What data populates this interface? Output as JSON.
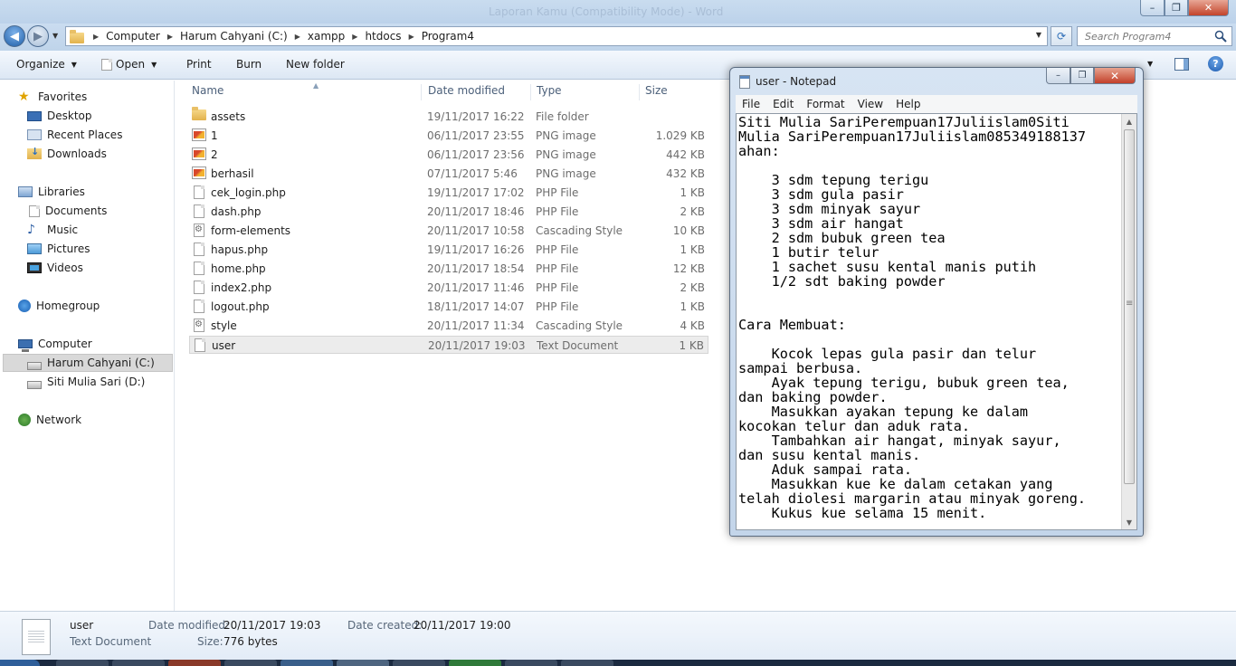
{
  "titlebar": {
    "faint_title": "Laporan Kamu (Compatibility Mode) - Word"
  },
  "window_controls": {
    "minimize": "–",
    "maximize": "❐",
    "close": "✕"
  },
  "nav": {
    "back": "◀",
    "forward": "▶",
    "breadcrumbs": [
      "Computer",
      "Harum Cahyani (C:)",
      "xampp",
      "htdocs",
      "Program4"
    ],
    "search_placeholder": "Search Program4"
  },
  "toolbar": {
    "organize": "Organize",
    "open": "Open",
    "print": "Print",
    "burn": "Burn",
    "new_folder": "New folder"
  },
  "sidebar": {
    "favorites": "Favorites",
    "desktop": "Desktop",
    "recent_places": "Recent Places",
    "downloads": "Downloads",
    "libraries": "Libraries",
    "documents": "Documents",
    "music": "Music",
    "pictures": "Pictures",
    "videos": "Videos",
    "homegroup": "Homegroup",
    "computer": "Computer",
    "drive_c": "Harum Cahyani (C:)",
    "drive_d": "Siti Mulia Sari (D:)",
    "network": "Network"
  },
  "filelist": {
    "columns": {
      "name": "Name",
      "date": "Date modified",
      "type": "Type",
      "size": "Size"
    },
    "files": [
      {
        "name": "assets",
        "date": "19/11/2017 16:22",
        "type": "File folder",
        "size": "",
        "icon": "folder-icon"
      },
      {
        "name": "1",
        "date": "06/11/2017 23:55",
        "type": "PNG image",
        "size": "1.029 KB",
        "icon": "png-image-icon"
      },
      {
        "name": "2",
        "date": "06/11/2017 23:56",
        "type": "PNG image",
        "size": "442 KB",
        "icon": "png-image-icon"
      },
      {
        "name": "berhasil",
        "date": "07/11/2017 5:46",
        "type": "PNG image",
        "size": "432 KB",
        "icon": "png-image-icon"
      },
      {
        "name": "cek_login.php",
        "date": "19/11/2017 17:02",
        "type": "PHP File",
        "size": "1 KB",
        "icon": "php-file-icon"
      },
      {
        "name": "dash.php",
        "date": "20/11/2017 18:46",
        "type": "PHP File",
        "size": "2 KB",
        "icon": "php-file-icon"
      },
      {
        "name": "form-elements",
        "date": "20/11/2017 10:58",
        "type": "Cascading Style S...",
        "size": "10 KB",
        "icon": "css-file-icon"
      },
      {
        "name": "hapus.php",
        "date": "19/11/2017 16:26",
        "type": "PHP File",
        "size": "1 KB",
        "icon": "php-file-icon"
      },
      {
        "name": "home.php",
        "date": "20/11/2017 18:54",
        "type": "PHP File",
        "size": "12 KB",
        "icon": "php-file-icon"
      },
      {
        "name": "index2.php",
        "date": "20/11/2017 11:46",
        "type": "PHP File",
        "size": "2 KB",
        "icon": "php-file-icon"
      },
      {
        "name": "logout.php",
        "date": "18/11/2017 14:07",
        "type": "PHP File",
        "size": "1 KB",
        "icon": "php-file-icon"
      },
      {
        "name": "style",
        "date": "20/11/2017 11:34",
        "type": "Cascading Style S...",
        "size": "4 KB",
        "icon": "css-file-icon"
      },
      {
        "name": "user",
        "date": "20/11/2017 19:03",
        "type": "Text Document",
        "size": "1 KB",
        "icon": "text-file-icon",
        "selected": true
      }
    ]
  },
  "details": {
    "name": "user",
    "type": "Text Document",
    "date_modified_label": "Date modified:",
    "date_modified": "20/11/2017 19:03",
    "date_created_label": "Date created:",
    "date_created": "20/11/2017 19:00",
    "size_label": "Size:",
    "size": "776 bytes"
  },
  "notepad": {
    "title": "user - Notepad",
    "menu": [
      "File",
      "Edit",
      "Format",
      "View",
      "Help"
    ],
    "content": "Siti Mulia SariPerempuan17Juliislam0Siti\nMulia SariPerempuan17Juliislam085349188137\nahan:\n\n    3 sdm tepung terigu\n    3 sdm gula pasir\n    3 sdm minyak sayur\n    3 sdm air hangat\n    2 sdm bubuk green tea\n    1 butir telur\n    1 sachet susu kental manis putih\n    1/2 sdt baking powder\n\n\nCara Membuat:\n\n    Kocok lepas gula pasir dan telur\nsampai berbusa.\n    Ayak tepung terigu, bubuk green tea,\ndan baking powder.\n    Masukkan ayakan tepung ke dalam\nkocokan telur dan aduk rata.\n    Tambahkan air hangat, minyak sayur,\ndan susu kental manis.\n    Aduk sampai rata.\n    Masukkan kue ke dalam cetakan yang\ntelah diolesi margarin atau minyak goreng.\n    Kukus kue selama 15 menit."
  }
}
